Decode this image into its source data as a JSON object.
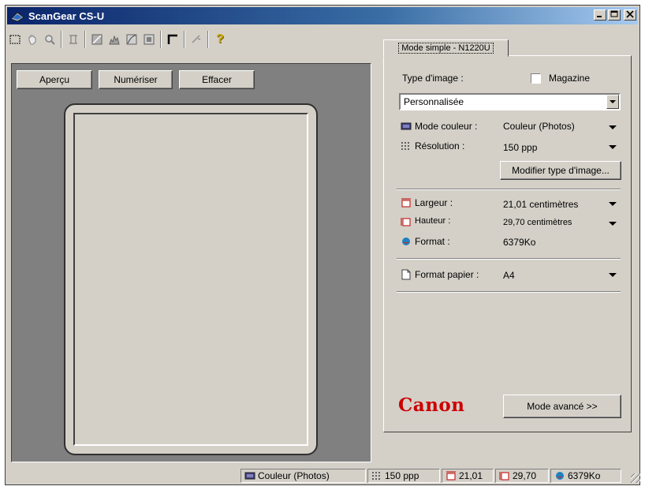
{
  "window": {
    "title": "ScanGear CS-U",
    "controls": [
      "_",
      "□",
      "×"
    ]
  },
  "toolbar": {
    "icons": [
      "select-area-icon",
      "hand-icon",
      "zoom-icon",
      "crop-icon",
      "brightness-icon",
      "histogram-icon",
      "tone-curve-icon",
      "threshold-icon",
      "auto-crop-icon",
      "settings-icon",
      "help-icon"
    ],
    "help_glyph": "?"
  },
  "preview": {
    "buttons": {
      "preview": "Aperçu",
      "scan": "Numériser",
      "clear": "Effacer"
    }
  },
  "tab": {
    "label": "Mode simple - N1220U"
  },
  "panel": {
    "image_type_label": "Type d'image :",
    "magazine_label": "Magazine",
    "image_type_value": "Personnalisée",
    "color_mode_label": "Mode couleur :",
    "color_mode_value": "Couleur (Photos)",
    "resolution_label": "Résolution :",
    "resolution_value": "150 ppp",
    "modify_button": "Modifier type d'image...",
    "width_label": "Largeur :",
    "width_value": "21,01 centimètres",
    "height_label": "Hauteur :",
    "height_value": "29,70 centimètres",
    "size_label": "Format :",
    "size_value": "6379Ko",
    "paper_label": "Format papier :",
    "paper_value": "A4",
    "brand": "Canon",
    "advanced_button": "Mode avancé >>"
  },
  "status": {
    "color_mode": "Couleur (Photos)",
    "resolution": "150 ppp",
    "width": "21,01",
    "height": "29,70",
    "size": "6379Ko"
  },
  "colors": {
    "brand_red": "#cc0000",
    "title_blue": "#0a246a",
    "face": "#d4d0c8",
    "preview_bg": "#808080"
  }
}
